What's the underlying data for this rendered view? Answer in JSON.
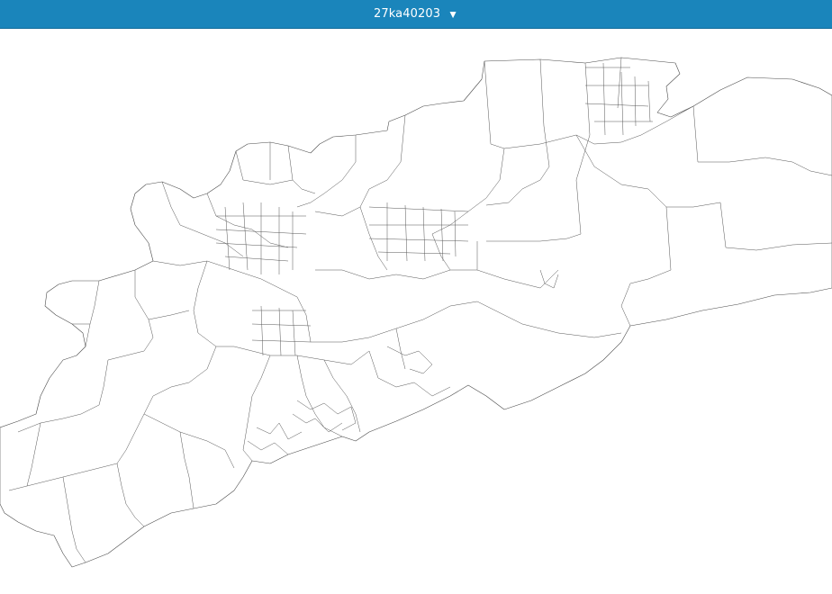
{
  "header": {
    "selector_label": "27ka40203",
    "caret_icon": "triangle-down",
    "background_color": "#1a85bb",
    "text_color": "#ffffff"
  },
  "map": {
    "type": "choropleth-outline",
    "fill_color": "#ffffff",
    "stroke_color": "#4a4a4a"
  }
}
